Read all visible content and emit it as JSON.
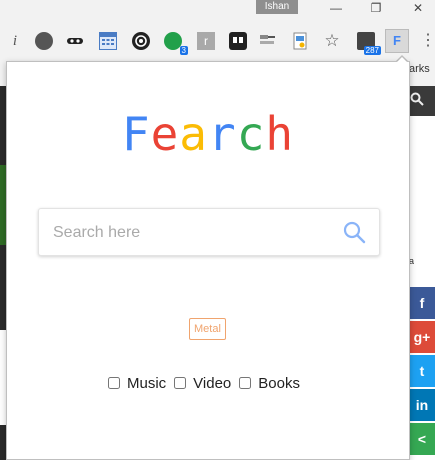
{
  "titlebar": {
    "user_name": "Ishan",
    "minimize_glyph": "—",
    "restore_glyph": "❐",
    "close_glyph": "✕"
  },
  "toolbar": {
    "extensions": [
      {
        "id": "info",
        "icon": "info-icon",
        "glyph": "i"
      },
      {
        "id": "ball",
        "icon": "ball-icon"
      },
      {
        "id": "mask",
        "icon": "mask-icon"
      },
      {
        "id": "calendar",
        "icon": "calendar-icon"
      },
      {
        "id": "spiral",
        "icon": "spiral-icon"
      },
      {
        "id": "green",
        "icon": "green-dot-icon",
        "badge": "3"
      },
      {
        "id": "r",
        "icon": "r-icon",
        "glyph": "r"
      },
      {
        "id": "tabs",
        "icon": "tabs-icon"
      },
      {
        "id": "stack",
        "icon": "stack-icon"
      },
      {
        "id": "doc",
        "icon": "doc-icon"
      },
      {
        "id": "star",
        "icon": "star-icon",
        "glyph": "☆"
      },
      {
        "id": "folder",
        "icon": "folder-icon",
        "badge": "287"
      },
      {
        "id": "fearch",
        "icon": "fearch-icon",
        "glyph": "F"
      },
      {
        "id": "menu",
        "icon": "menu-icon",
        "glyph": "⋮"
      }
    ],
    "bookmarks_fragment": "arks"
  },
  "background_page": {
    "right_text": "a",
    "share_glyphs": {
      "facebook": "f",
      "gplus": "g+",
      "twitter": "t",
      "linkedin": "in",
      "sharethis": "<"
    }
  },
  "popup": {
    "logo_letters": [
      {
        "char": "F",
        "color": "#4285f4"
      },
      {
        "char": "e",
        "color": "#ea4335"
      },
      {
        "char": "a",
        "color": "#fbbc05"
      },
      {
        "char": "r",
        "color": "#4285f4"
      },
      {
        "char": "c",
        "color": "#34a853"
      },
      {
        "char": "h",
        "color": "#ea4335"
      }
    ],
    "search": {
      "placeholder": "Search here",
      "value": "",
      "icon_color": "#8ab4f8"
    },
    "tag": "Metal",
    "filters": [
      {
        "label": "Music",
        "checked": false
      },
      {
        "label": "Video",
        "checked": false
      },
      {
        "label": "Books",
        "checked": false
      }
    ]
  }
}
